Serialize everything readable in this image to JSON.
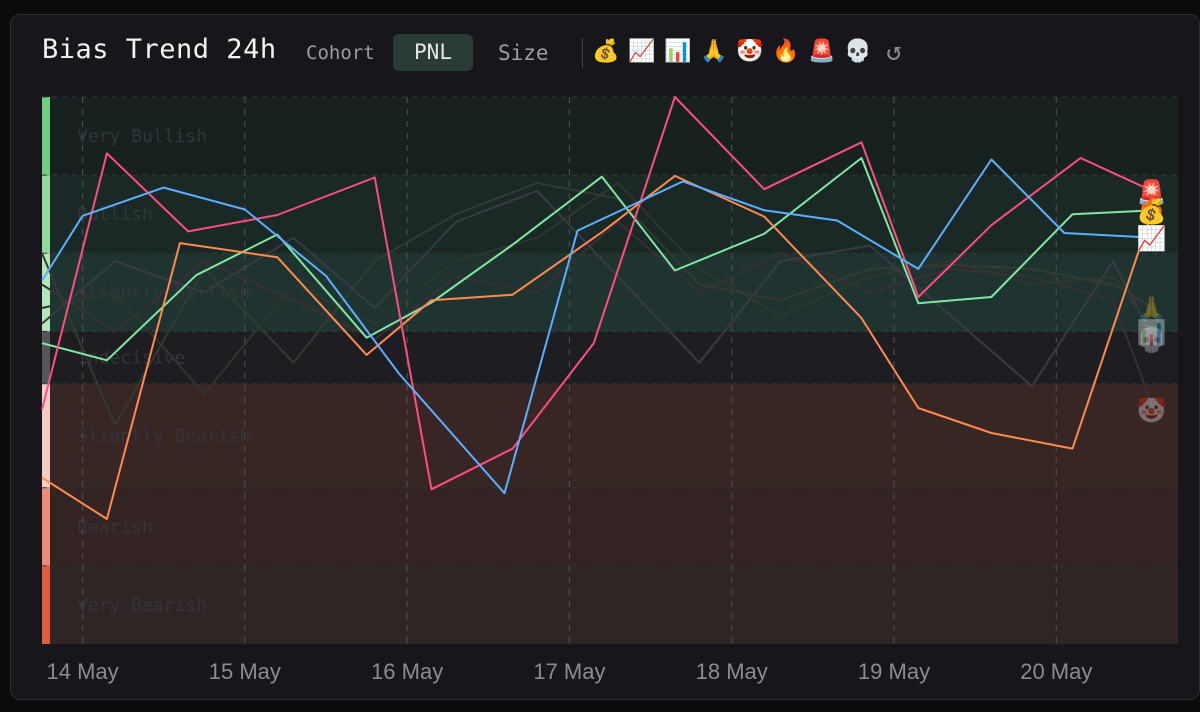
{
  "header": {
    "title": "Bias Trend 24h",
    "cohort_label": "Cohort",
    "pnl_label": "PNL",
    "size_label": "Size",
    "toolbar_icons": [
      {
        "name": "money-bag-icon",
        "glyph": "💰"
      },
      {
        "name": "chart-increasing-icon",
        "glyph": "📈"
      },
      {
        "name": "bar-chart-icon",
        "glyph": "📊"
      },
      {
        "name": "folded-hands-icon",
        "glyph": "🙏"
      },
      {
        "name": "clown-face-icon",
        "glyph": "🤡"
      },
      {
        "name": "fire-icon",
        "glyph": "🔥"
      },
      {
        "name": "police-light-icon",
        "glyph": "🚨"
      },
      {
        "name": "skull-icon",
        "glyph": "💀"
      },
      {
        "name": "reset-icon",
        "glyph": "↺"
      }
    ]
  },
  "chart_data": {
    "type": "line",
    "title": "Bias Trend 24h",
    "x_ticks": [
      "14 May",
      "15 May",
      "16 May",
      "17 May",
      "18 May",
      "19 May",
      "20 May"
    ],
    "x_range": [
      13.75,
      20.75
    ],
    "y_range": [
      0,
      7
    ],
    "zones": [
      {
        "name": "Very Bullish",
        "from": 6,
        "to": 7,
        "fill": "#162120",
        "edge": "#6fcf7f"
      },
      {
        "name": "Bullish",
        "from": 5,
        "to": 6,
        "fill": "#1a2826",
        "edge": "#8fd99a"
      },
      {
        "name": "Slightly Bullish",
        "from": 4,
        "to": 5,
        "fill": "#1f3430",
        "edge": "#b3e6b9"
      },
      {
        "name": "Indecisive",
        "from": 3.33,
        "to": 4,
        "fill": "#1d1d22",
        "edge": "#55555b"
      },
      {
        "name": "Slightly Bearish",
        "from": 2,
        "to": 3.33,
        "fill": "#382625",
        "edge": "#f3cdc4"
      },
      {
        "name": "Bearish",
        "from": 1,
        "to": 2,
        "fill": "#332423",
        "edge": "#ec8b77"
      },
      {
        "name": "Very Bearish",
        "from": 0,
        "to": 1,
        "fill": "#2f2525",
        "edge": "#e25d40"
      }
    ],
    "series": [
      {
        "color": "#5ab0ff",
        "icon": "📈",
        "x": [
          13.75,
          14.0,
          14.5,
          15.0,
          15.5,
          15.95,
          16.6,
          17.05,
          17.7,
          18.2,
          18.65,
          19.15,
          19.6,
          20.05,
          20.6
        ],
        "y": [
          4.65,
          5.48,
          5.84,
          5.56,
          4.71,
          3.46,
          1.93,
          5.29,
          5.92,
          5.55,
          5.42,
          4.8,
          6.2,
          5.26,
          5.2
        ]
      },
      {
        "color": "#ff4d7e",
        "icon": "🚨",
        "x": [
          13.75,
          14.15,
          14.65,
          15.2,
          15.8,
          16.15,
          16.65,
          17.15,
          17.65,
          18.2,
          18.8,
          19.15,
          19.6,
          20.15,
          20.6
        ],
        "y": [
          3.0,
          6.28,
          5.28,
          5.49,
          5.97,
          1.98,
          2.5,
          3.85,
          7.0,
          5.82,
          6.42,
          4.44,
          5.36,
          6.22,
          5.79
        ]
      },
      {
        "color": "#ff8a50",
        "icon": "🔥",
        "x": [
          13.75,
          14.15,
          14.6,
          15.2,
          15.75,
          16.15,
          16.65,
          17.2,
          17.65,
          18.2,
          18.8,
          19.15,
          19.6,
          20.1,
          20.6
        ],
        "y": [
          2.13,
          1.6,
          5.13,
          4.95,
          3.7,
          4.4,
          4.47,
          5.27,
          5.99,
          5.47,
          4.17,
          3.02,
          2.7,
          2.5,
          5.6
        ]
      },
      {
        "color": "#7ee8a2",
        "icon": "💰",
        "x": [
          13.75,
          14.15,
          14.7,
          15.2,
          15.75,
          16.15,
          16.65,
          17.2,
          17.65,
          18.2,
          18.8,
          19.15,
          19.6,
          20.1,
          20.6
        ],
        "y": [
          3.85,
          3.63,
          4.72,
          5.24,
          3.92,
          4.37,
          5.11,
          5.98,
          4.78,
          5.25,
          6.22,
          4.36,
          4.44,
          5.5,
          5.55
        ]
      },
      {
        "color": "#3a3a42",
        "icon": "💀",
        "x": [
          13.75,
          14.2,
          14.75,
          15.3,
          15.8,
          16.3,
          16.8,
          17.3,
          17.8,
          18.3,
          18.85,
          19.35,
          19.85,
          20.35,
          20.6
        ],
        "y": [
          4.1,
          4.9,
          4.5,
          5.2,
          4.3,
          5.4,
          5.8,
          4.7,
          3.6,
          4.9,
          5.1,
          4.2,
          3.3,
          4.9,
          3.9
        ]
      },
      {
        "color": "#333b30",
        "icon": "🙏",
        "x": [
          13.75,
          14.2,
          14.75,
          15.3,
          15.8,
          16.3,
          16.8,
          17.3,
          17.8,
          18.3,
          18.85,
          19.35,
          19.85,
          20.35,
          20.6
        ],
        "y": [
          5.0,
          2.8,
          4.8,
          3.6,
          4.9,
          5.5,
          5.9,
          5.7,
          4.6,
          4.4,
          4.8,
          4.85,
          4.8,
          4.6,
          4.3
        ]
      },
      {
        "color": "#2e3630",
        "icon": "📊",
        "x": [
          13.75,
          14.2,
          14.75,
          15.3,
          15.8,
          16.3,
          16.8,
          17.3,
          17.8,
          18.3,
          18.85,
          19.35,
          19.85,
          20.35,
          20.6
        ],
        "y": [
          4.3,
          4.5,
          3.2,
          4.6,
          4.1,
          4.9,
          5.2,
          5.9,
          4.8,
          4.2,
          4.7,
          4.9,
          4.6,
          4.7,
          4.0
        ]
      },
      {
        "color": "#3a2f36",
        "icon": "🤡",
        "x": [
          13.75,
          14.2,
          14.75,
          15.3,
          15.8,
          16.3,
          16.8,
          17.3,
          17.8,
          18.3,
          18.85,
          19.35,
          19.85,
          20.35,
          20.6
        ],
        "y": [
          4.6,
          4.0,
          4.9,
          4.4,
          3.9,
          4.7,
          4.5,
          5.4,
          4.5,
          5.0,
          4.5,
          4.8,
          4.7,
          4.4,
          3.0
        ]
      }
    ]
  }
}
